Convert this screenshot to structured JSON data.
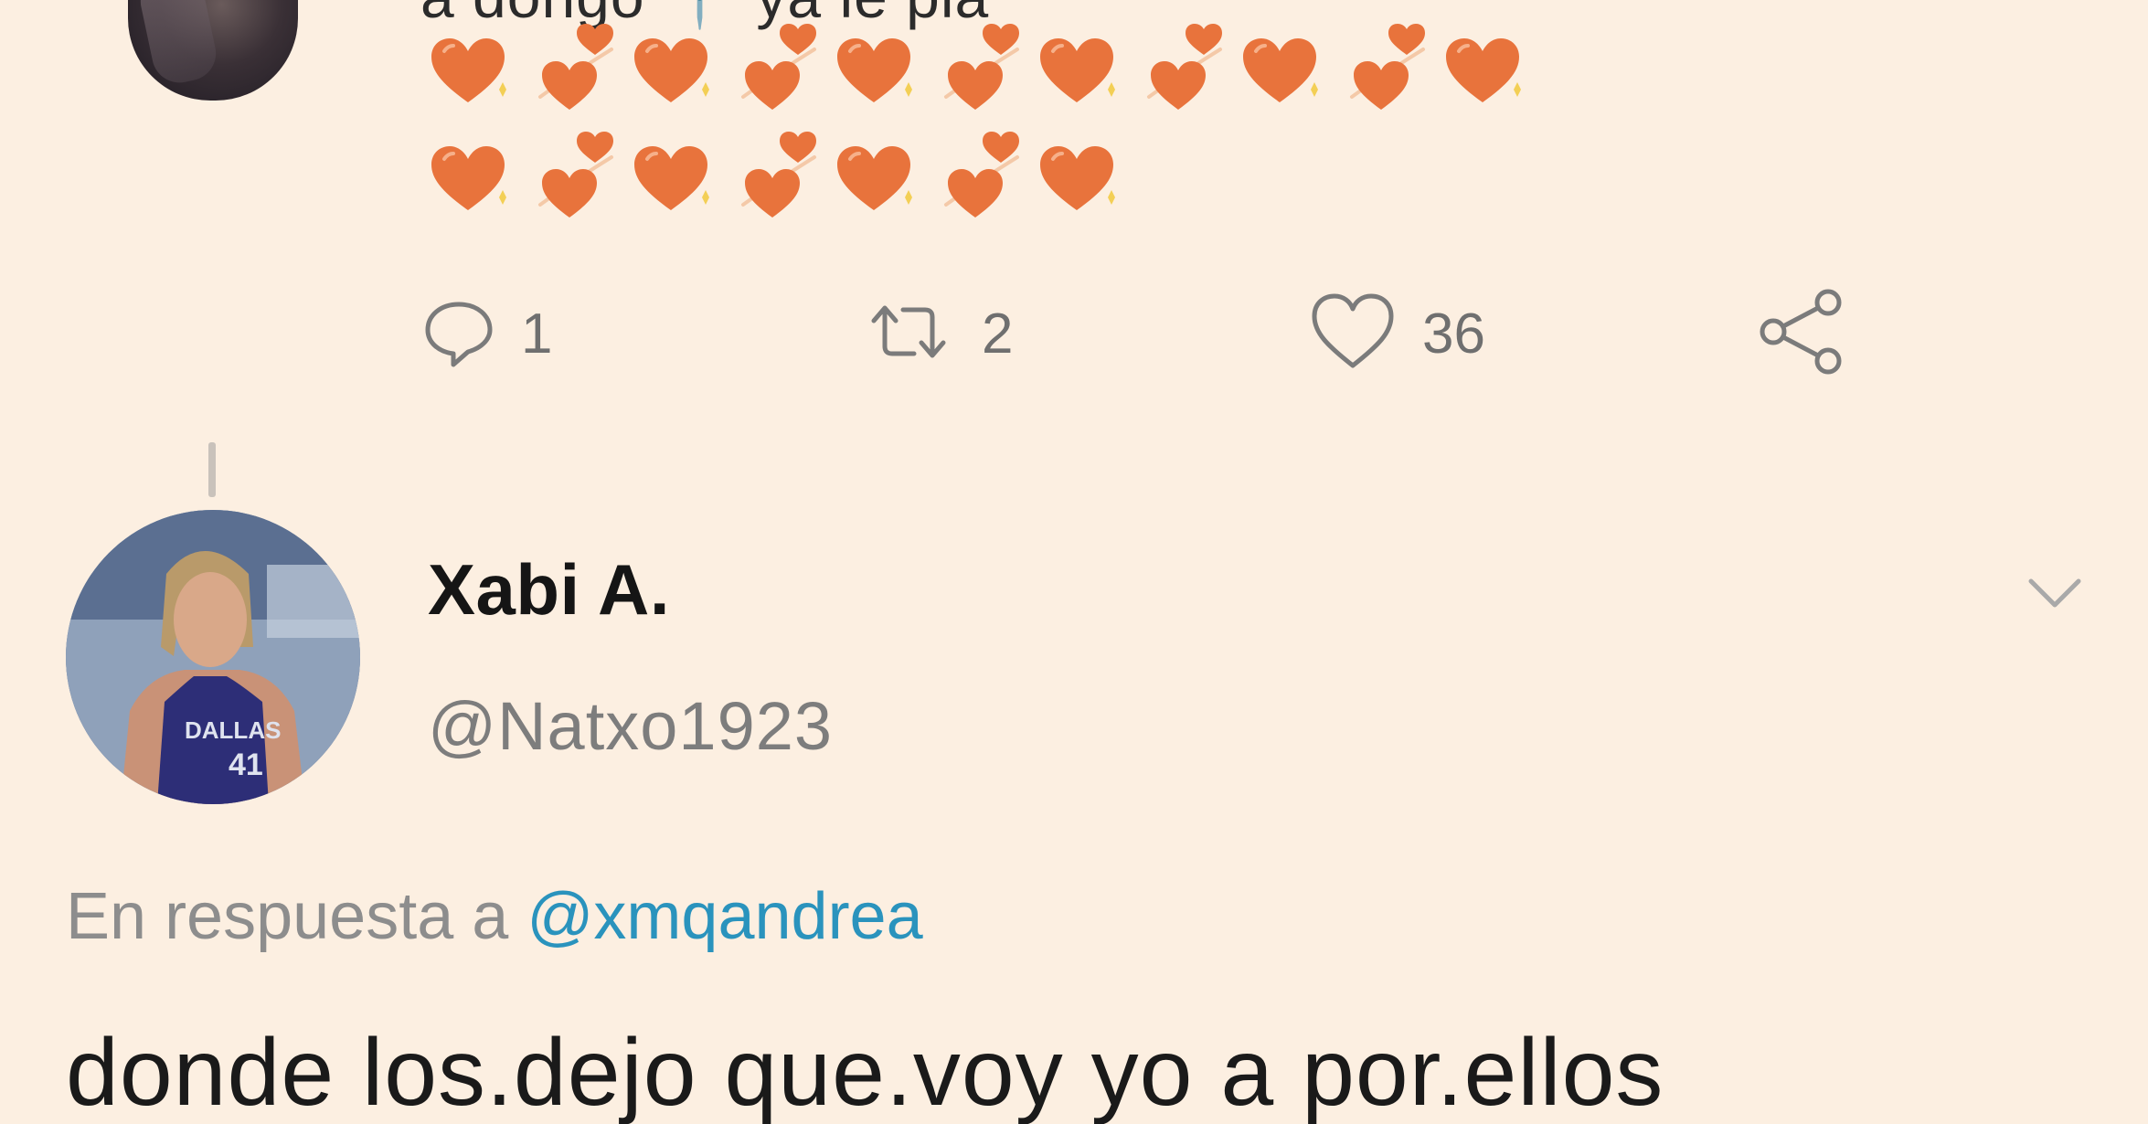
{
  "previous_tweet": {
    "partial_text": "a dongo 📍 ya le pla",
    "emoji_rows": [
      [
        "orange-heart",
        "two-hearts",
        "orange-heart",
        "two-hearts",
        "orange-heart",
        "two-hearts",
        "orange-heart",
        "two-hearts",
        "orange-heart",
        "two-hearts",
        "orange-heart"
      ],
      [
        "orange-heart",
        "two-hearts",
        "orange-heart",
        "two-hearts",
        "orange-heart",
        "two-hearts",
        "orange-heart"
      ]
    ],
    "actions": {
      "reply_count": "1",
      "retweet_count": "2",
      "like_count": "36"
    }
  },
  "reply_tweet": {
    "display_name": "Xabi A.",
    "handle": "@Natxo1923",
    "reply_prefix": "En respuesta a",
    "reply_mention": "@xmqandrea",
    "text": "donde los.dejo que.voy yo a por.ellos"
  },
  "colors": {
    "background": "#fcefe1",
    "mention": "#2a93bd",
    "heart": "#e8733c"
  },
  "icons": [
    "reply-icon",
    "retweet-icon",
    "like-icon",
    "share-icon",
    "chevron-down-icon"
  ]
}
